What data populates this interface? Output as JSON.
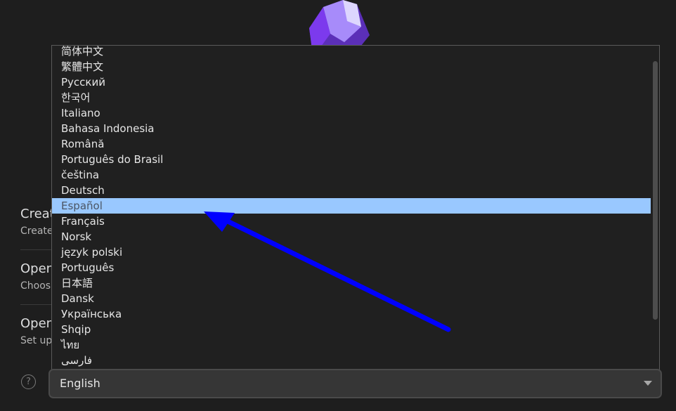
{
  "background_actions": [
    {
      "title": "Creat",
      "description": "Create"
    },
    {
      "title": "Open",
      "description": "Choos"
    },
    {
      "title": "Open",
      "description": "Set up"
    }
  ],
  "language_list": {
    "options": [
      "简体中文",
      "繁體中文",
      "Русский",
      "한국어",
      "Italiano",
      "Bahasa Indonesia",
      "Română",
      "Português do Brasil",
      "čeština",
      "Deutsch",
      "Español",
      "Français",
      "Norsk",
      "język polski",
      "Português",
      "日本語",
      "Dansk",
      "Українська",
      "Shqip",
      "ไทย",
      "فارسی"
    ],
    "highlighted": "Español"
  },
  "language_select": {
    "value": "English"
  },
  "help_icon": {
    "glyph": "?"
  },
  "colors": {
    "background": "#1e1e1e",
    "highlight": "#99c8ff",
    "annotation_arrow": "#0000ff",
    "logo": "#8b5cf6"
  },
  "icons": [
    "obsidian-logo-icon",
    "help-icon",
    "chevron-down-icon",
    "annotation-arrow"
  ]
}
